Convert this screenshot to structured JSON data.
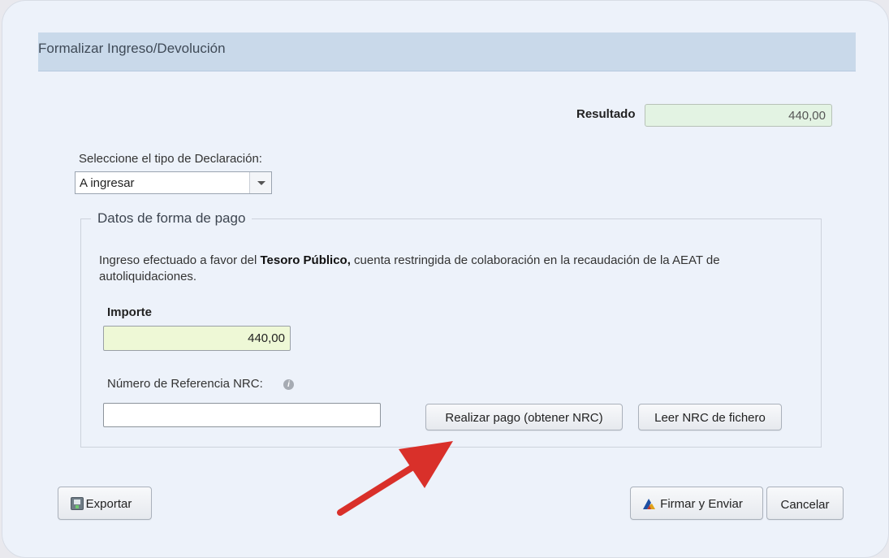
{
  "dialog": {
    "title": "Formalizar Ingreso/Devolución"
  },
  "resultado": {
    "label": "Resultado",
    "value": "440,00"
  },
  "tipo_declaracion": {
    "label": "Seleccione el tipo de Declaración:",
    "selected": "A ingresar"
  },
  "forma_pago": {
    "legend": "Datos de forma de pago",
    "info_prefix": "Ingreso efectuado a favor del ",
    "info_bold": "Tesoro Público,",
    "info_suffix": " cuenta restringida de colaboración en la recaudación de la AEAT de autoliquidaciones.",
    "importe_label": "Importe",
    "importe_value": "440,00",
    "nrc_label": "Número de Referencia NRC:",
    "nrc_value": "",
    "btn_realizar_pago": "Realizar pago (obtener NRC)",
    "btn_leer_nrc": "Leer NRC de fichero"
  },
  "footer": {
    "btn_exportar": "Exportar",
    "btn_firmar": "Firmar y Enviar",
    "btn_cancelar": "Cancelar"
  },
  "colors": {
    "title_bar": "#c9d9ea",
    "resultado_field": "#e3f3e3",
    "importe_field": "#eef8d6",
    "annotation_arrow": "#d9302a"
  },
  "icons": {
    "info": "info-icon",
    "export": "export-icon",
    "sign": "sign-icon",
    "dropdown": "chevron-down-icon",
    "annotation": "arrow-pointer-icon"
  }
}
